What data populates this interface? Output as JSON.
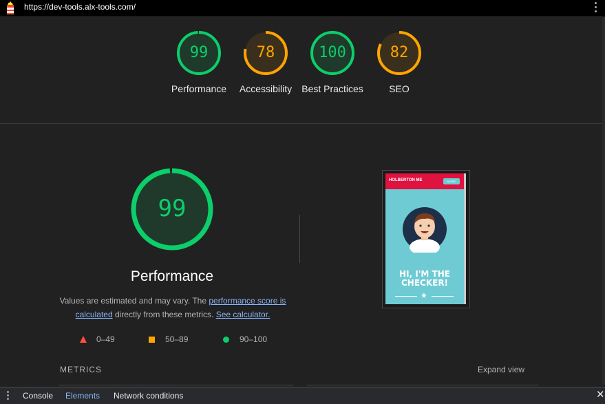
{
  "browser": {
    "url": "https://dev-tools.alx-tools.com/"
  },
  "summary": {
    "gauges": [
      {
        "label": "Performance",
        "score": "99",
        "fraction": 0.99,
        "rating": "pass"
      },
      {
        "label": "Accessibility",
        "score": "78",
        "fraction": 0.78,
        "rating": "average"
      },
      {
        "label": "Best Practices",
        "score": "100",
        "fraction": 1.0,
        "rating": "pass"
      },
      {
        "label": "SEO",
        "score": "82",
        "fraction": 0.82,
        "rating": "average"
      }
    ]
  },
  "performance": {
    "score": "99",
    "fraction": 0.99,
    "title": "Performance",
    "desc_prefix": "Values are estimated and may vary. The ",
    "link_score": "performance score is calculated",
    "desc_middle": " directly from these metrics. ",
    "link_calc": "See calculator."
  },
  "legend": {
    "fail": "0–49",
    "average": "50–89",
    "pass": "90–100"
  },
  "thumbnail": {
    "brand": "HOLBERTON ME",
    "button": "MORE",
    "headline_1": "HI, I'M THE",
    "headline_2": "CHECKER!"
  },
  "metrics": {
    "heading": "METRICS",
    "expand_label": "Expand view"
  },
  "devtools": {
    "tabs": [
      "Console",
      "Elements",
      "Network conditions"
    ],
    "active_tab": "Elements"
  },
  "colors": {
    "pass": "#0cce6b",
    "average": "#ffa400",
    "fail": "#ff4e42",
    "link": "#8ab4f8"
  }
}
